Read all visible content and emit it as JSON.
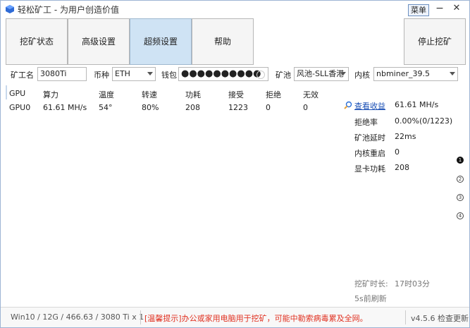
{
  "window": {
    "title": "轻松矿工 - 为用户创造价值",
    "menu_label": "菜单",
    "minimize_glyph": "−",
    "close_glyph": "✕"
  },
  "toolbar": {
    "mining_status": "挖矿状态",
    "advanced_settings": "高级设置",
    "overclock_settings": "超频设置",
    "help": "帮助",
    "stop_mining": "停止挖矿"
  },
  "config": {
    "miner_name_label": "矿工名",
    "miner_name_value": "3080Ti",
    "coin_label": "币种",
    "coin_value": "ETH",
    "wallet_label": "钱包",
    "wallet_value": "●●●●●●●●●●",
    "pool_label": "矿池",
    "pool_value": "风池-SLL香港",
    "kernel_label": "内核",
    "kernel_value": "nbminer_39.5"
  },
  "gpu_table": {
    "headers": [
      "GPU",
      "算力",
      "温度",
      "转速",
      "功耗",
      "接受",
      "拒绝",
      "无效"
    ],
    "rows": [
      [
        "GPU0",
        "61.61 MH/s",
        "54°",
        "80%",
        "208",
        "1223",
        "0",
        "0"
      ]
    ]
  },
  "stats": {
    "earnings_link": "查看收益",
    "hashrate": "61.61 MH/s",
    "reject_rate_label": "拒绝率",
    "reject_rate_value": "0.00%(0/1223)",
    "pool_latency_label": "矿池延时",
    "pool_latency_value": "22ms",
    "kernel_restart_label": "内核重启",
    "kernel_restart_value": "0",
    "gpu_power_label": "显卡功耗",
    "gpu_power_value": "208"
  },
  "pager": {
    "pages": [
      "1",
      "2",
      "3",
      "4"
    ],
    "active_page": "1"
  },
  "timer": {
    "mining_duration_label": "挖矿时长:",
    "mining_duration_value": "17时03分",
    "refresh_text": "5s前刷新"
  },
  "statusbar": {
    "system_info": "Win10 / 12G / 466.63 / 3080 Ti x 1",
    "tip": "[温馨提示]办公或家用电脑用于挖矿，可能中勒索病毒累及全网。",
    "version": "v4.5.6 检查更新"
  },
  "colors": {
    "accent_blue": "#1a4fb5",
    "active_tab_bg": "#cfe3f4",
    "tip_red": "#e03020"
  }
}
